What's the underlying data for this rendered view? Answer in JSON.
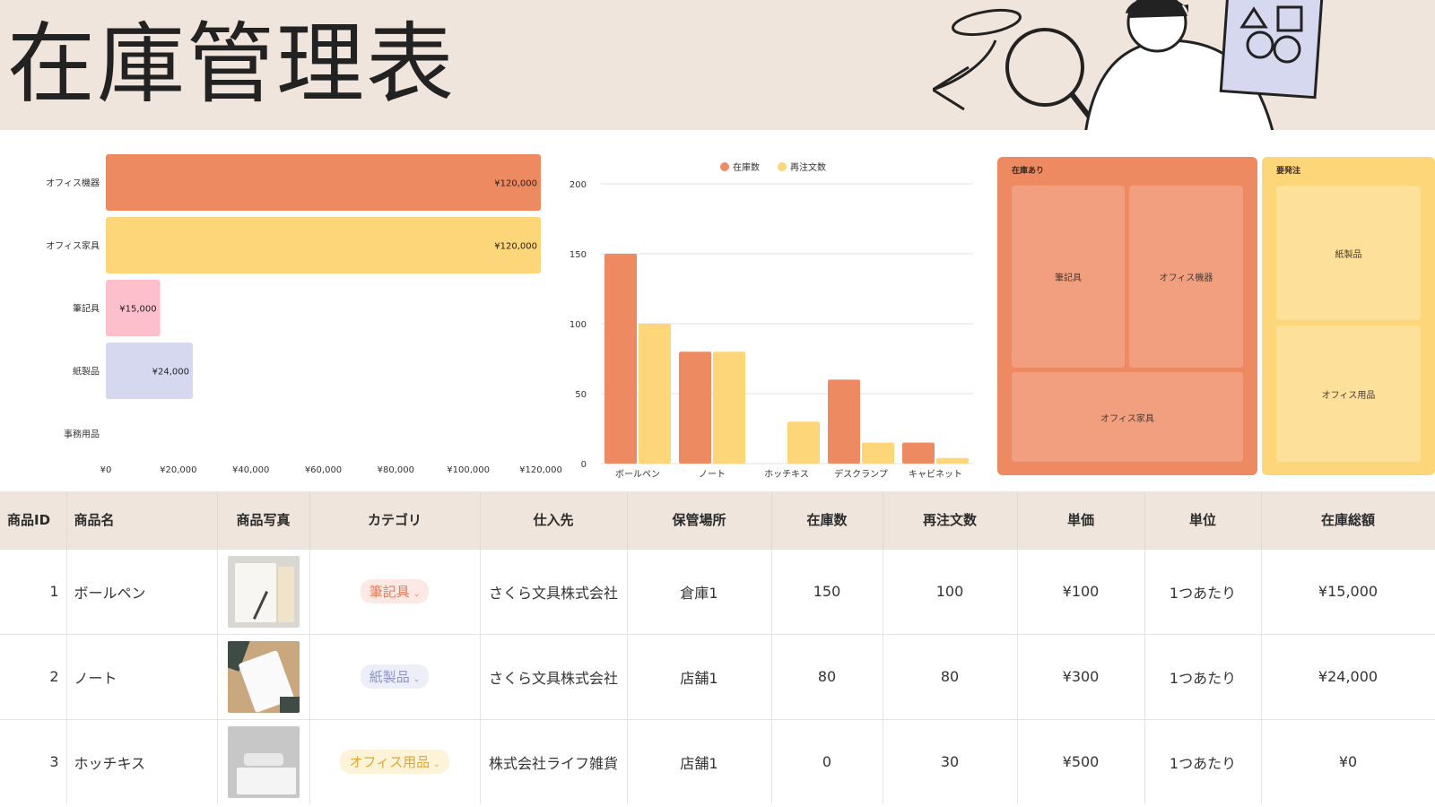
{
  "header": {
    "title": "在庫管理表"
  },
  "colors": {
    "orange": "#ee8a62",
    "yellow": "#fdd679",
    "pink": "#fdbfcb",
    "lavender": "#d6d8f0",
    "header_bg": "#efe5dd"
  },
  "bar_chart": {
    "type": "bar",
    "orientation": "horizontal",
    "categories": [
      "オフィス機器",
      "オフィス家具",
      "筆記具",
      "紙製品",
      "事務用品"
    ],
    "values": [
      120000,
      120000,
      15000,
      24000,
      0
    ],
    "data_labels": [
      "¥120,000",
      "¥120,000",
      "¥15,000",
      "¥24,000",
      ""
    ],
    "bar_colors": [
      "#ee8a62",
      "#fdd679",
      "#fdbfcb",
      "#d6d8f0",
      "#cccccc"
    ],
    "xticks": [
      "¥0",
      "¥20,000",
      "¥40,000",
      "¥60,000",
      "¥80,000",
      "¥100,000",
      "¥120,000"
    ],
    "xlim": [
      0,
      120000
    ],
    "grid": false
  },
  "chart_data": {
    "type": "bar",
    "categories": [
      "ボールペン",
      "ノート",
      "ホッチキス",
      "デスクランプ",
      "キャビネット"
    ],
    "series": [
      {
        "name": "在庫数",
        "values": [
          150,
          80,
          0,
          60,
          15
        ],
        "color": "#ee8a62"
      },
      {
        "name": "再注文数",
        "values": [
          100,
          80,
          30,
          15,
          4
        ],
        "color": "#fdd679"
      }
    ],
    "yticks": [
      "0",
      "50",
      "100",
      "150",
      "200"
    ],
    "ylim": [
      0,
      200
    ],
    "grid": true,
    "legend": "top-center"
  },
  "treemap": {
    "groups": [
      {
        "label": "在庫あり",
        "color": "#ee8a62",
        "tiles": [
          "筆記具",
          "オフィス機器",
          "オフィス家具"
        ]
      },
      {
        "label": "要発注",
        "color": "#fdd679",
        "tiles": [
          "紙製品",
          "オフィス用品"
        ]
      }
    ]
  },
  "table": {
    "headers": [
      "商品ID",
      "商品名",
      "商品写真",
      "カテゴリ",
      "仕入先",
      "保管場所",
      "在庫数",
      "再注文数",
      "単価",
      "単位",
      "在庫総額"
    ],
    "rows": [
      {
        "id": "1",
        "name": "ボールペン",
        "photo": "pen-photo",
        "category": "筆記具",
        "category_fg": "#e57a5c",
        "category_bg": "#fde9e3",
        "supplier": "さくら文具株式会社",
        "location": "倉庫1",
        "stock": "150",
        "reorder": "100",
        "price": "¥100",
        "unit": "1つあたり",
        "total": "¥15,000"
      },
      {
        "id": "2",
        "name": "ノート",
        "photo": "notebook-photo",
        "category": "紙製品",
        "category_fg": "#8e93c9",
        "category_bg": "#eceef8",
        "supplier": "さくら文具株式会社",
        "location": "店舗1",
        "stock": "80",
        "reorder": "80",
        "price": "¥300",
        "unit": "1つあたり",
        "total": "¥24,000"
      },
      {
        "id": "3",
        "name": "ホッチキス",
        "photo": "stapler-photo",
        "category": "オフィス用品",
        "category_fg": "#e0a630",
        "category_bg": "#fdf3d8",
        "supplier": "株式会社ライフ雑貨",
        "location": "店舗1",
        "stock": "0",
        "reorder": "30",
        "price": "¥500",
        "unit": "1つあたり",
        "total": "¥0"
      }
    ]
  }
}
